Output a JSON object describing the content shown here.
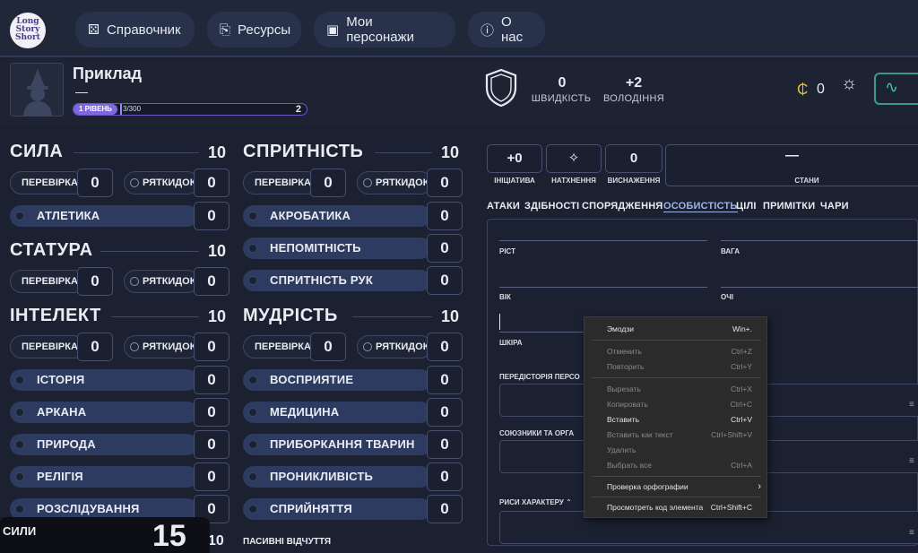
{
  "nav": {
    "logo": "Long Story Short",
    "items": [
      {
        "label": "Справочник",
        "icon": "dice-icon"
      },
      {
        "label": "Ресурсы",
        "icon": "paperclip-icon"
      },
      {
        "label": "Мои персонажи",
        "icon": "portrait-icon"
      },
      {
        "label": "О нас",
        "icon": "info-icon"
      }
    ]
  },
  "character": {
    "name": "Приклад",
    "subtitle": "—",
    "level_label": "1 РІВЕНЬ",
    "xp": "3/300",
    "xp_progress": 0.01,
    "next_level": "2",
    "speed_value": "0",
    "speed_label": "ШВИДКІСТЬ",
    "proficiency_value": "+2",
    "proficiency_label": "ВОЛОДІННЯ",
    "coins": "0"
  },
  "attributes": {
    "strength": {
      "title": "СИЛА",
      "value": "10",
      "check": "ПЕРЕВІРКА",
      "check_val": "0",
      "save": "РЯТКИДОК",
      "save_val": "0",
      "skills": [
        {
          "label": "АТЛЕТИКА",
          "value": "0"
        }
      ]
    },
    "constitution": {
      "title": "СТАТУРА",
      "value": "10",
      "check": "ПЕРЕВІРКА",
      "check_val": "0",
      "save": "РЯТКИДОК",
      "save_val": "0"
    },
    "intelligence": {
      "title": "ІНТЕЛЕКТ",
      "value": "10",
      "check": "ПЕРЕВІРКА",
      "check_val": "0",
      "save": "РЯТКИДОК",
      "save_val": "0",
      "skills": [
        {
          "label": "ІСТОРІЯ",
          "value": "0"
        },
        {
          "label": "АРКАНА",
          "value": "0"
        },
        {
          "label": "ПРИРОДА",
          "value": "0"
        },
        {
          "label": "РЕЛІГІЯ",
          "value": "0"
        },
        {
          "label": "РОЗСЛІДУВАННЯ",
          "value": "0"
        }
      ]
    },
    "dexterity": {
      "title": "СПРИТНІСТЬ",
      "value": "10",
      "check": "ПЕРЕВІРКА",
      "check_val": "0",
      "save": "РЯТКИДОК",
      "save_val": "0",
      "skills": [
        {
          "label": "АКРОБАТИКА",
          "value": "0"
        },
        {
          "label": "НЕПОМІТНІСТЬ",
          "value": "0"
        },
        {
          "label": "СПРИТНІСТЬ РУК",
          "value": "0"
        }
      ]
    },
    "wisdom": {
      "title": "МУДРІСТЬ",
      "value": "10",
      "check": "ПЕРЕВІРКА",
      "check_val": "0",
      "save": "РЯТКИДОК",
      "save_val": "0",
      "skills": [
        {
          "label": "ВОСПРИЯТИЕ",
          "value": "0"
        },
        {
          "label": "МЕДИЦИНА",
          "value": "0"
        },
        {
          "label": "ПРИБОРКАННЯ ТВАРИН",
          "value": "0"
        },
        {
          "label": "ПРОНИКЛИВІСТЬ",
          "value": "0"
        },
        {
          "label": "СПРИЙНЯТТЯ",
          "value": "0"
        }
      ]
    },
    "next_section_value": "10",
    "passive_label": "ПАСИВНІ ВІДЧУТТЯ"
  },
  "combat": {
    "initiative_val": "+0",
    "initiative_label": "ІНІЦІАТИВА",
    "inspiration_label": "НАТХНЕННЯ",
    "exhaustion_val": "0",
    "exhaustion_label": "ВИСНАЖЕННЯ",
    "conditions_val": "—",
    "conditions_label": "СТАНИ"
  },
  "tabs": [
    "АТАКИ",
    "ЗДІБНОСТІ",
    "СПОРЯДЖЕННЯ",
    "ОСОБИСТІСТЬ",
    "ЦІЛІ",
    "ПРИМІТКИ",
    "ЧАРИ"
  ],
  "personality": {
    "height_label": "РІСТ",
    "weight_label": "ВАГА",
    "age_label": "ВІК",
    "eyes_label": "ОЧІ",
    "skin_label": "ШКІРА",
    "backstory_label": "ПЕРЕДІСТОРІЯ ПЕРСО",
    "allies_label": "СОЮЗНИКИ ТА ОРГА",
    "traits_label": "РИСИ ХАРАКТЕРУ"
  },
  "context_menu": [
    {
      "label": "Эмодзи",
      "shortcut": "Win+.",
      "disabled": false
    },
    {
      "label": "Отменить",
      "shortcut": "Ctrl+Z",
      "disabled": true
    },
    {
      "label": "Повторить",
      "shortcut": "Ctrl+Y",
      "disabled": true
    },
    {
      "label": "Вырезать",
      "shortcut": "Ctrl+X",
      "disabled": true
    },
    {
      "label": "Копировать",
      "shortcut": "Ctrl+C",
      "disabled": true
    },
    {
      "label": "Вставить",
      "shortcut": "Ctrl+V",
      "disabled": false
    },
    {
      "label": "Вставить как текст",
      "shortcut": "Ctrl+Shift+V",
      "disabled": true
    },
    {
      "label": "Удалить",
      "shortcut": "",
      "disabled": true
    },
    {
      "label": "Выбрать все",
      "shortcut": "Ctrl+A",
      "disabled": true
    },
    {
      "label": "Проверка орфографии",
      "shortcut": "›",
      "disabled": false
    },
    {
      "label": "Просмотреть код элемента",
      "shortcut": "Ctrl+Shift+C",
      "disabled": false
    }
  ],
  "popup": {
    "label": "СИЛИ",
    "value": "15"
  },
  "colors": {
    "accent": "#8067e0",
    "skill": "#2d3b60",
    "heal": "#48c2ad",
    "gold": "#e3c33a"
  }
}
